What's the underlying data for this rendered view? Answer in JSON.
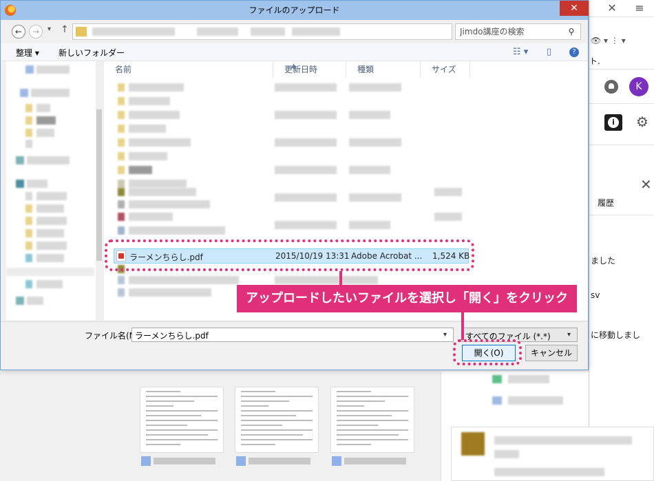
{
  "dialog": {
    "title": "ファイルのアップロード",
    "close_symbol": "✕",
    "search_placeholder": "Jimdo講座の検索",
    "toolbar": {
      "organize": "整理 ▾",
      "new_folder": "新しいフォルダー"
    },
    "columns": {
      "name": "名前",
      "date": "更新日時",
      "type": "種類",
      "size": "サイズ"
    },
    "selected_file": {
      "name": "ラーメンちらし.pdf",
      "date": "2015/10/19 13:31",
      "type": "Adobe Acrobat ...",
      "size": "1,524 KB"
    },
    "filename_label": "ファイル名(N):",
    "filename_value": "ラーメンちらし.pdf",
    "filetype_value": "すべてのファイル (*.*)",
    "open_button": "開く(O)",
    "cancel_button": "キャンセル"
  },
  "annotation": {
    "text": "アップロードしたいファイルを選択し「開く」をクリック",
    "color": "#e0307a"
  },
  "background": {
    "avatar_letter": "K",
    "avatar_color": "#7b2fbf",
    "partial_texts": [
      "ト.",
      "履歴",
      "ました",
      "sv",
      "に移動しまし"
    ]
  }
}
